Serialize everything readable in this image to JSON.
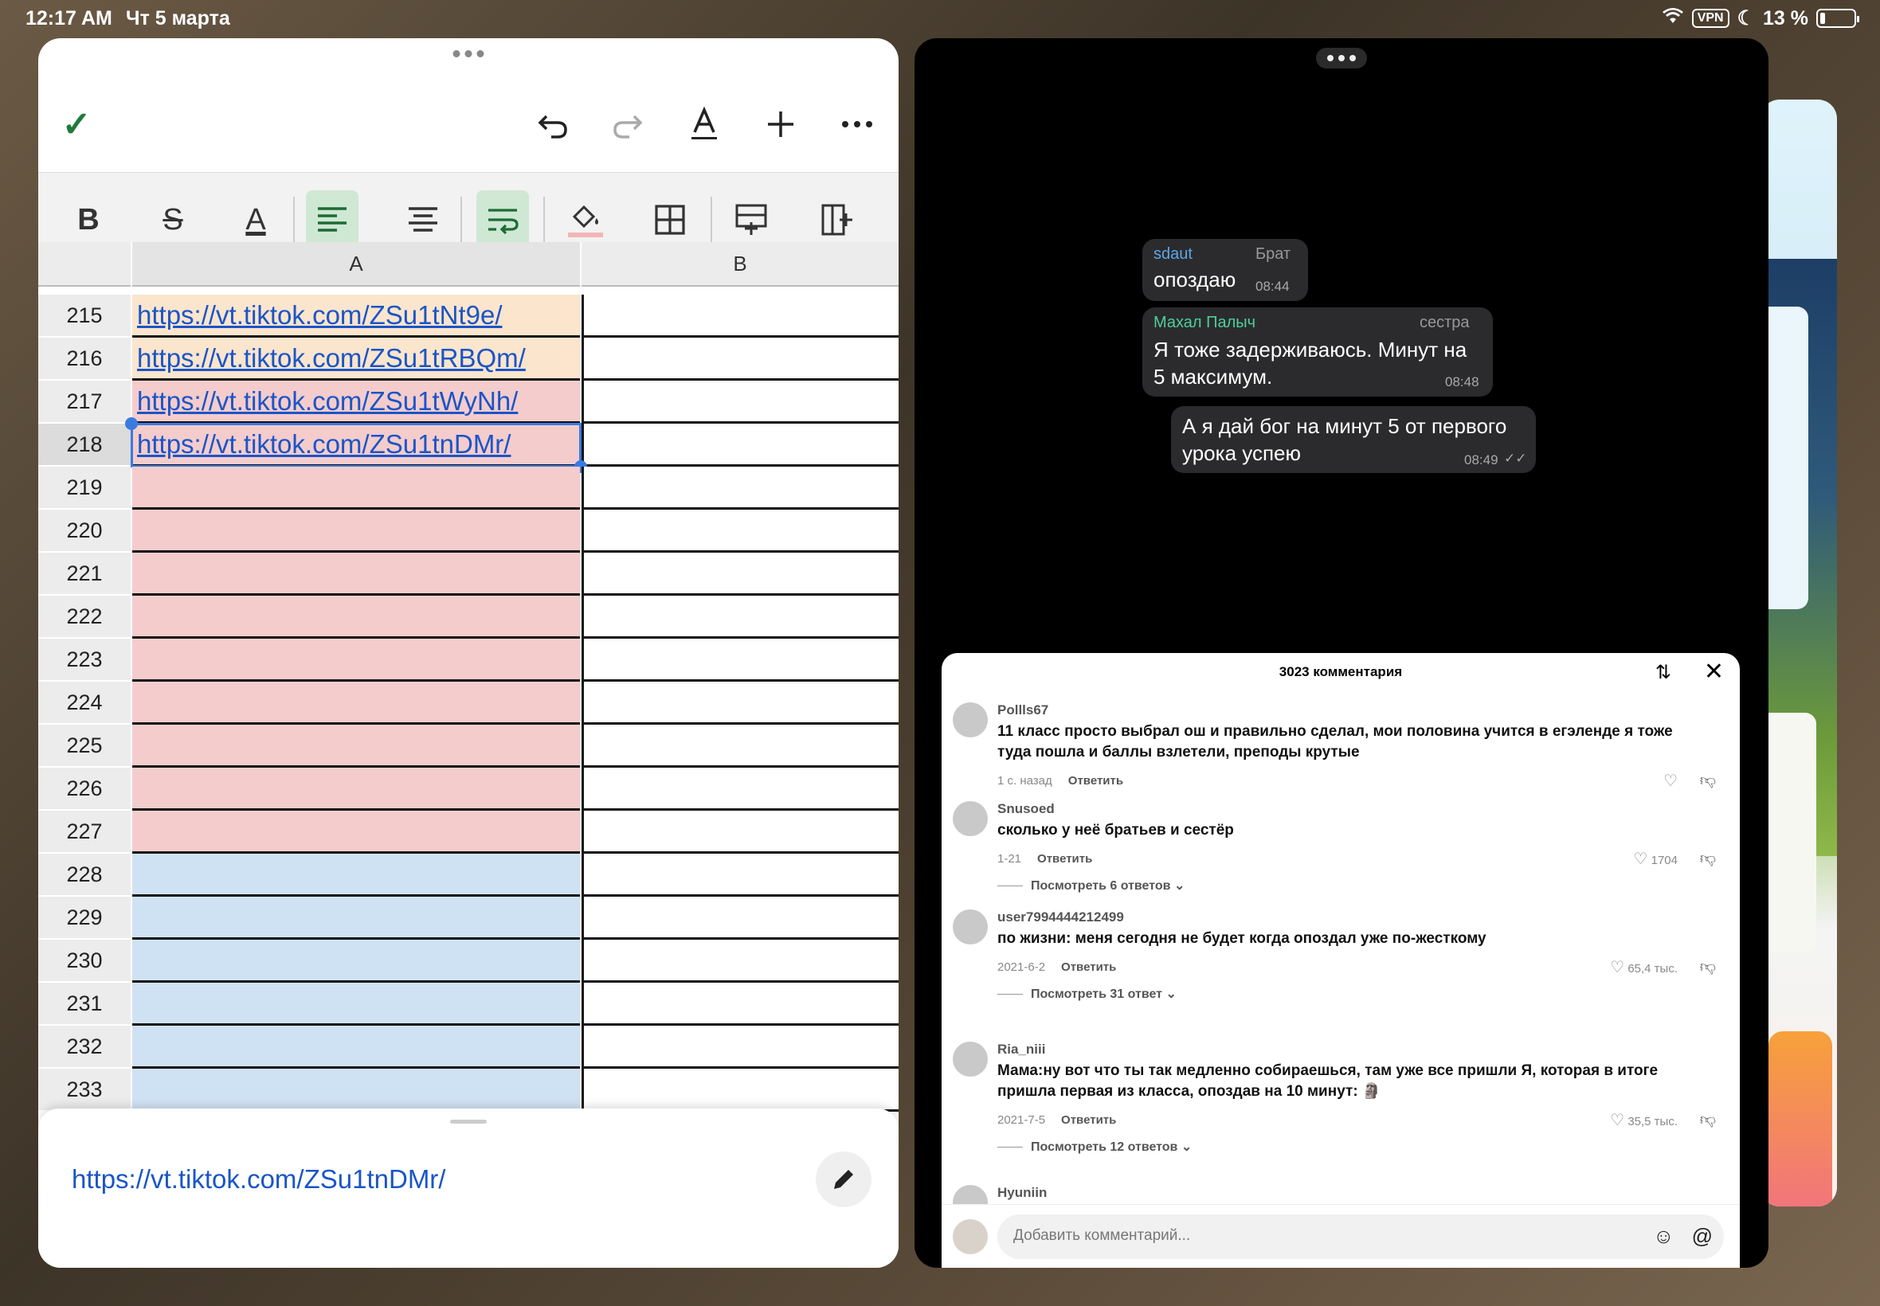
{
  "status": {
    "time": "12:17 AM",
    "date": "Чт 5 марта",
    "vpn": "VPN",
    "battery": "13 %"
  },
  "toolbar": {
    "done_icon": "checkmark-icon",
    "undo_icon": "undo-icon",
    "redo_icon": "redo-icon",
    "text_format_icon": "text-format-icon",
    "add_icon": "plus-icon",
    "more_icon": "ellipsis-icon"
  },
  "format": {
    "bold": "B",
    "strike": "S",
    "text_color": "A",
    "items": [
      "bold-icon",
      "strikethrough-icon",
      "text-color-icon",
      "align-left-icon",
      "align-center-icon",
      "wrap-text-icon",
      "fill-color-icon",
      "borders-icon",
      "insert-row-icon",
      "insert-column-icon"
    ]
  },
  "sheet": {
    "columns": [
      "A",
      "B"
    ],
    "rows": [
      {
        "num": "215",
        "a": "https://vt.tiktok.com/ZSu1tNt9e/",
        "color": "orange"
      },
      {
        "num": "216",
        "a": "https://vt.tiktok.com/ZSu1tRBQm/",
        "color": "orange"
      },
      {
        "num": "217",
        "a": "https://vt.tiktok.com/ZSu1tWyNh/",
        "color": "red"
      },
      {
        "num": "218",
        "a": "https://vt.tiktok.com/ZSu1tnDMr/",
        "color": "red"
      },
      {
        "num": "219",
        "a": "",
        "color": "red"
      },
      {
        "num": "220",
        "a": "",
        "color": "red"
      },
      {
        "num": "221",
        "a": "",
        "color": "red"
      },
      {
        "num": "222",
        "a": "",
        "color": "red"
      },
      {
        "num": "223",
        "a": "",
        "color": "red"
      },
      {
        "num": "224",
        "a": "",
        "color": "red"
      },
      {
        "num": "225",
        "a": "",
        "color": "red"
      },
      {
        "num": "226",
        "a": "",
        "color": "red"
      },
      {
        "num": "227",
        "a": "",
        "color": "red"
      },
      {
        "num": "228",
        "a": "",
        "color": "blue"
      },
      {
        "num": "229",
        "a": "",
        "color": "blue"
      },
      {
        "num": "230",
        "a": "",
        "color": "blue"
      },
      {
        "num": "231",
        "a": "",
        "color": "blue"
      },
      {
        "num": "232",
        "a": "",
        "color": "blue"
      },
      {
        "num": "233",
        "a": "",
        "color": "blue"
      }
    ],
    "cell_editor_value": "https://vt.tiktok.com/ZSu1tnDMr/"
  },
  "chat": {
    "messages": [
      {
        "sender": "sdaut",
        "role": "Брат",
        "text": "опоздаю",
        "time": "08:44"
      },
      {
        "sender": "Махал Палыч",
        "role": "сестра",
        "text": "Я тоже задерживаюсь. Минут на 5 максимум.",
        "time": "08:48"
      },
      {
        "sender": "",
        "role": "",
        "text": "А я дай бог на минут 5 от первого урока успею",
        "time": "08:49"
      }
    ]
  },
  "comments": {
    "title": "3023 комментария",
    "reply_label": "Ответить",
    "input_placeholder": "Добавить комментарий...",
    "items": [
      {
        "user": "Pollls67",
        "text": "11 класс просто выбрал ош и правильно сделал, мои половина учится в егэленде я тоже туда пошла и баллы взлетели, преподы крутые",
        "date": "1 с. назад",
        "likes": "",
        "more": ""
      },
      {
        "user": "Snusoed",
        "text": "сколько у неё братьев и сестёр",
        "date": "1-21",
        "likes": "1704",
        "more": "Посмотреть 6 ответов"
      },
      {
        "user": "user7994444212499",
        "text": "по жизни: меня сегодня не будет когда опоздал уже по-жесткому",
        "date": "2021-6-2",
        "likes": "65,4 тыс.",
        "more": "Посмотреть 31 ответ"
      },
      {
        "user": "Ria_niii",
        "text": "Мама:ну вот что ты так медленно собираешься, там уже все пришли Я, которая в итоге пришла первая из класса, опоздав на 10 минут: 🗿",
        "date": "2021-7-5",
        "likes": "35,5 тыс.",
        "more": "Посмотреть 12 ответов"
      },
      {
        "user": "Hyuniin",
        "text": "",
        "date": "",
        "likes": "",
        "more": ""
      }
    ]
  }
}
